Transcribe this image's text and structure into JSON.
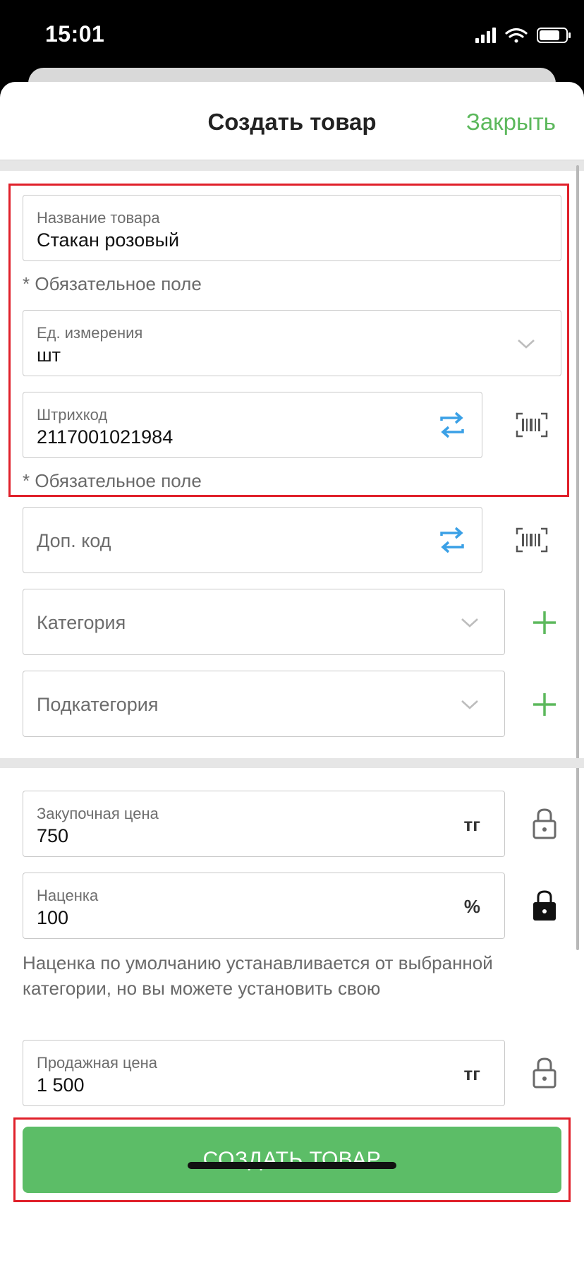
{
  "status_bar": {
    "time": "15:01"
  },
  "header": {
    "title": "Создать товар",
    "close_label": "Закрыть"
  },
  "fields": {
    "name": {
      "label": "Название товара",
      "value": "Стакан розовый",
      "hint": "* Обязательное поле"
    },
    "unit": {
      "label": "Ед. измерения",
      "value": "шт"
    },
    "barcode": {
      "label": "Штрихкод",
      "value": "2117001021984",
      "hint": "* Обязательное поле"
    },
    "extra_code": {
      "placeholder": "Доп. код"
    },
    "category": {
      "placeholder": "Категория"
    },
    "subcategory": {
      "placeholder": "Подкатегория"
    },
    "purchase_price": {
      "label": "Закупочная цена",
      "value": "750",
      "suffix": "тг"
    },
    "markup": {
      "label": "Наценка",
      "value": "100",
      "suffix": "%",
      "hint": "Наценка по умолчанию устанавливается от выбранной категории, но вы можете установить свою"
    },
    "sale_price": {
      "label": "Продажная цена",
      "value": "1 500",
      "suffix": "тг"
    }
  },
  "create_button": {
    "label": "СОЗДАТЬ ТОВАР"
  },
  "icons": {
    "refresh": "refresh-icon",
    "barcode_scan": "barcode-scan-icon",
    "chevron": "chevron-down-icon",
    "add": "plus-icon",
    "lock_open": "lock-open-icon",
    "lock_closed": "lock-closed-icon"
  },
  "colors": {
    "accent_green": "#5cb85c",
    "button_green": "#5cbd67",
    "refresh_blue": "#3aa0e6",
    "highlight_red": "#e0202a"
  }
}
